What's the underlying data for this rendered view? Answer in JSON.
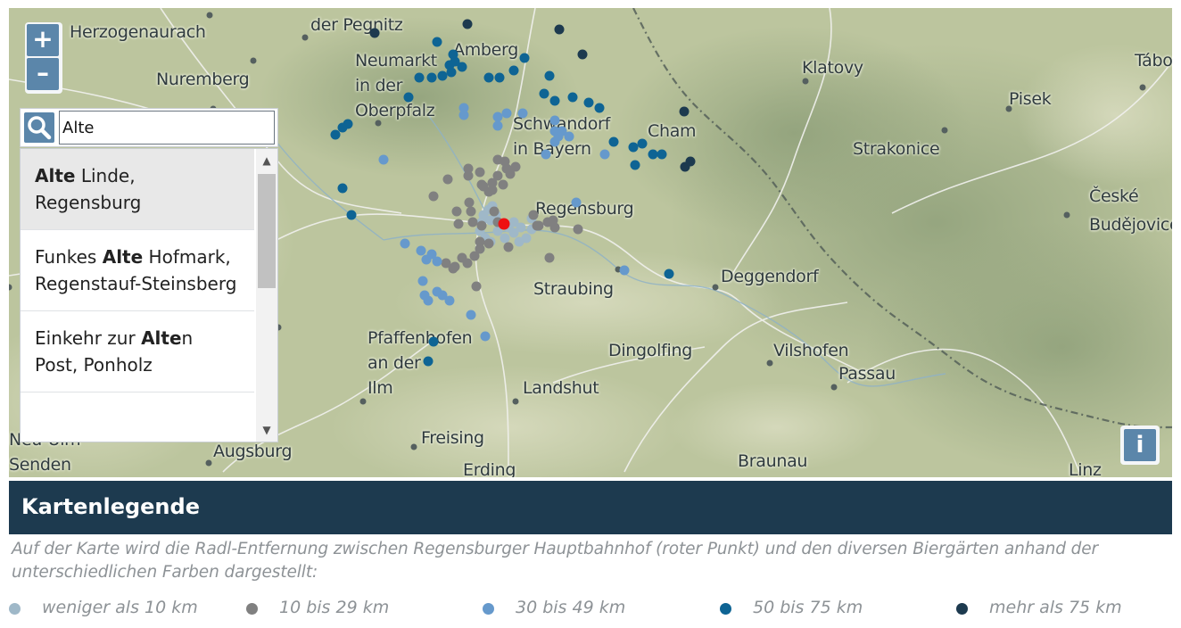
{
  "map": {
    "zoom_in_label": "+",
    "zoom_out_label": "–",
    "info_label": "i",
    "places": [
      {
        "name": "Herzogenaurach"
      },
      {
        "name": "der Pegnitz"
      },
      {
        "name": "Amberg"
      },
      {
        "name": "Neumarkt"
      },
      {
        "name": "in der"
      },
      {
        "name": "Oberpfalz"
      },
      {
        "name": "Nuremberg"
      },
      {
        "name": "Schwandorf"
      },
      {
        "name": "in Bayern"
      },
      {
        "name": "Cham"
      },
      {
        "name": "Klatovy"
      },
      {
        "name": "Tábo"
      },
      {
        "name": "Pisek"
      },
      {
        "name": "Strakonice"
      },
      {
        "name": "České"
      },
      {
        "name": "Budějovice"
      },
      {
        "name": "Regensburg"
      },
      {
        "name": "Straubing"
      },
      {
        "name": "Deggendorf"
      },
      {
        "name": "Pfaffenhofen"
      },
      {
        "name": "an der"
      },
      {
        "name": "Ilm"
      },
      {
        "name": "Dingolfing"
      },
      {
        "name": "Vilshofen"
      },
      {
        "name": "Passau"
      },
      {
        "name": "Landshut"
      },
      {
        "name": "Freising"
      },
      {
        "name": "Erding"
      },
      {
        "name": "Augsburg"
      },
      {
        "name": "Senden"
      },
      {
        "name": "Neu-Ulm"
      },
      {
        "name": "Braunau"
      },
      {
        "name": "Linz"
      }
    ],
    "station_color": "#ee1111"
  },
  "search": {
    "value": "Alte",
    "suggestions": [
      {
        "match": "Alte",
        "pre": "",
        "post": " Linde, Regensburg",
        "highlighted": true
      },
      {
        "match": "Alte",
        "pre": "Funkes ",
        "post": " Hofmark, Regenstauf-Steinsberg",
        "highlighted": false
      },
      {
        "match": "Alte",
        "pre": "Einkehr zur ",
        "post": "n Post, Ponholz",
        "highlighted": false
      }
    ]
  },
  "legend": {
    "title": "Kartenlegende",
    "description": "Auf der Karte wird die Radl-Entfernung zwischen Regensburger Hauptbahnhof (roter Punkt) und den diversen Biergärten anhand der unterschiedlichen Farben dargestellt:",
    "items": [
      {
        "label": "weniger als 10 km",
        "color": "#9fb8c8"
      },
      {
        "label": "10 bis 29 km",
        "color": "#808080"
      },
      {
        "label": "30 bis 49 km",
        "color": "#6699cc"
      },
      {
        "label": "50 bis 75 km",
        "color": "#0e6494"
      },
      {
        "label": "mehr als 75 km",
        "color": "#1d3a4f"
      }
    ]
  }
}
